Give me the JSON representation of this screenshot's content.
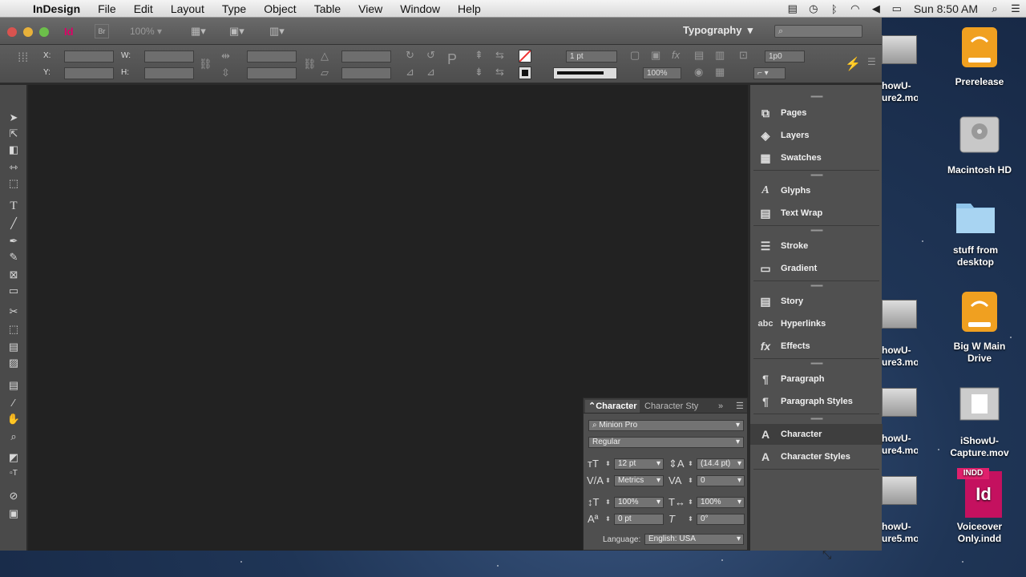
{
  "menubar": {
    "app_name": "InDesign",
    "items": [
      "File",
      "Edit",
      "Layout",
      "Type",
      "Object",
      "Table",
      "View",
      "Window",
      "Help"
    ],
    "clock": "Sun 8:50 AM"
  },
  "appbar": {
    "zoom": "100%",
    "workspace": "Typography"
  },
  "control": {
    "x_label": "X:",
    "y_label": "Y:",
    "w_label": "W:",
    "h_label": "H:",
    "stroke_weight": "1 pt",
    "opacity": "100%",
    "offset": "1p0"
  },
  "dock": {
    "items": [
      {
        "label": "Pages",
        "icon": "pages-icon"
      },
      {
        "label": "Layers",
        "icon": "layers-icon"
      },
      {
        "label": "Swatches",
        "icon": "swatches-icon"
      },
      {
        "label": "Glyphs",
        "icon": "glyphs-icon"
      },
      {
        "label": "Text Wrap",
        "icon": "text-wrap-icon"
      },
      {
        "label": "Stroke",
        "icon": "stroke-icon"
      },
      {
        "label": "Gradient",
        "icon": "gradient-icon"
      },
      {
        "label": "Story",
        "icon": "story-icon"
      },
      {
        "label": "Hyperlinks",
        "icon": "hyperlinks-icon"
      },
      {
        "label": "Effects",
        "icon": "effects-icon"
      },
      {
        "label": "Paragraph",
        "icon": "paragraph-icon"
      },
      {
        "label": "Paragraph Styles",
        "icon": "paragraph-styles-icon"
      },
      {
        "label": "Character",
        "icon": "character-icon"
      },
      {
        "label": "Character Styles",
        "icon": "character-styles-icon"
      }
    ]
  },
  "character_panel": {
    "tab_character": "Character",
    "tab_character_styles": "Character Sty",
    "font_family": "Minion Pro",
    "font_style": "Regular",
    "font_size": "12 pt",
    "leading": "(14.4 pt)",
    "kerning": "Metrics",
    "tracking": "0",
    "vertical_scale": "100%",
    "horizontal_scale": "100%",
    "baseline_shift": "0 pt",
    "skew": "0°",
    "language_label": "Language:",
    "language": "English: USA"
  },
  "desktop": {
    "icons": [
      {
        "label": "Prerelease"
      },
      {
        "label": "Macintosh HD"
      },
      {
        "label": "stuff from desktop"
      },
      {
        "label": "Big W Main Drive"
      },
      {
        "label": "iShowU-Capture.mov"
      },
      {
        "label": "Voiceover Only.indd",
        "badge": "INDD",
        "glyph": "Id"
      }
    ],
    "partial_files": [
      "howU-\nure2.mov",
      "howU-\nure3.mov",
      "howU-\nure4.mov",
      "howU-\nure5.mov"
    ]
  }
}
